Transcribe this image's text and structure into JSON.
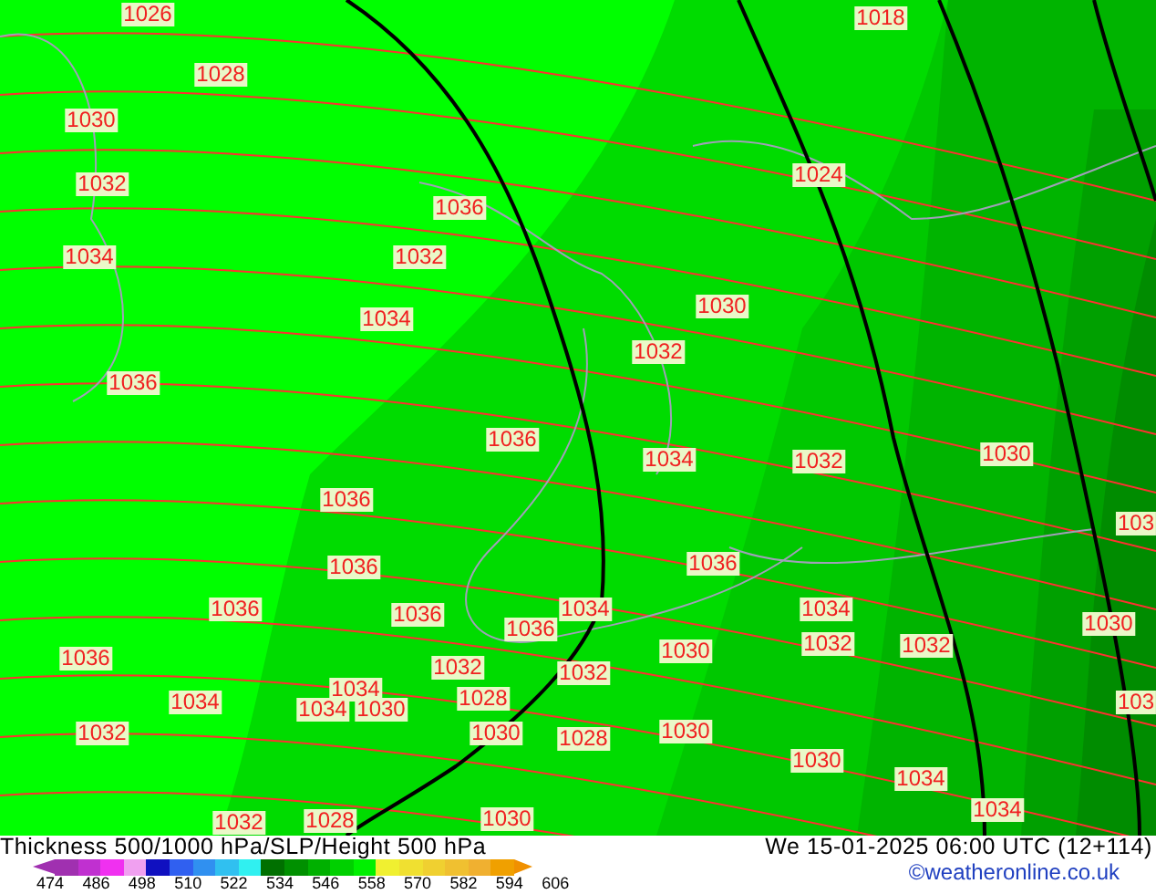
{
  "map": {
    "isobar_labels": [
      "1026",
      "1018",
      "1028",
      "1030",
      "1024",
      "1032",
      "1036",
      "1032",
      "1034",
      "1034",
      "1030",
      "1032",
      "1036",
      "1036",
      "1034",
      "1032",
      "1030",
      "1036",
      "1036",
      "1036",
      "103",
      "1036",
      "1036",
      "1034",
      "1034",
      "1036",
      "1030",
      "1032",
      "1032",
      "1030",
      "1036",
      "1032",
      "1032",
      "1034",
      "1034",
      "1034",
      "1030",
      "1028",
      "103",
      "1032",
      "1030",
      "1028",
      "1030",
      "1030",
      "1034",
      "1034",
      "1032",
      "1028",
      "1030"
    ]
  },
  "footer": {
    "title": "Thickness 500/1000 hPa/SLP/Height 500 hPa",
    "valid_time": "We 15-01-2025 06:00 UTC (12+114)",
    "legend": {
      "swatches": [
        {
          "kind": "arrow-left",
          "color": "#a030b0"
        },
        {
          "kind": "box",
          "color": "#a030b0"
        },
        {
          "kind": "box",
          "color": "#c030d0"
        },
        {
          "kind": "box",
          "color": "#f030f0"
        },
        {
          "kind": "box",
          "color": "#f0a0f0"
        },
        {
          "kind": "box",
          "color": "#1010c0"
        },
        {
          "kind": "box",
          "color": "#3060f0"
        },
        {
          "kind": "box",
          "color": "#3090f0"
        },
        {
          "kind": "box",
          "color": "#30c0f0"
        },
        {
          "kind": "box",
          "color": "#30f0f0"
        },
        {
          "kind": "box",
          "color": "#007000"
        },
        {
          "kind": "box",
          "color": "#009000"
        },
        {
          "kind": "box",
          "color": "#00b000"
        },
        {
          "kind": "box",
          "color": "#00d000"
        },
        {
          "kind": "box",
          "color": "#00f000"
        },
        {
          "kind": "box",
          "color": "#f0f030"
        },
        {
          "kind": "box",
          "color": "#f0e030"
        },
        {
          "kind": "box",
          "color": "#f0d030"
        },
        {
          "kind": "box",
          "color": "#f0c030"
        },
        {
          "kind": "box",
          "color": "#f0b030"
        },
        {
          "kind": "box",
          "color": "#f0a000"
        },
        {
          "kind": "arrow-right",
          "color": "#f09000"
        }
      ],
      "ticks": [
        "474",
        "486",
        "498",
        "510",
        "522",
        "534",
        "546",
        "558",
        "570",
        "582",
        "594",
        "606"
      ]
    },
    "credit": "©weatheronline.co.uk"
  }
}
